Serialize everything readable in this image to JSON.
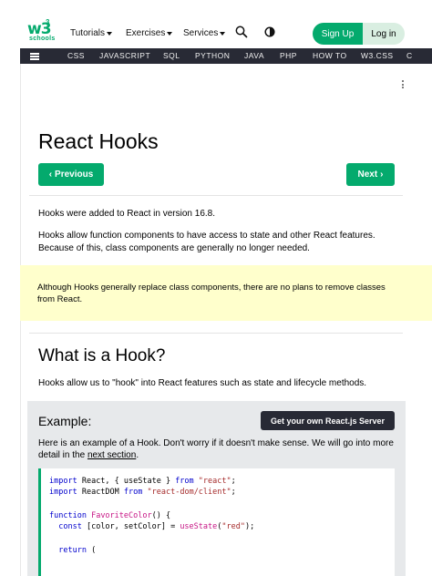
{
  "header": {
    "logo_text": "w3",
    "logo_superscript": "3",
    "logo_sub": "schools",
    "menus": [
      "Tutorials",
      "Exercises",
      "Services"
    ],
    "icons": [
      "search-icon",
      "contrast-icon"
    ],
    "signup_label": "Sign Up",
    "login_label": "Log in"
  },
  "topnav": {
    "items": [
      "CSS",
      "JAVASCRIPT",
      "SQL",
      "PYTHON",
      "JAVA",
      "PHP",
      "HOW TO",
      "W3.CSS",
      "C"
    ]
  },
  "page": {
    "title": "React Hooks",
    "prev_label": "Previous",
    "next_label": "Next",
    "intro1": "Hooks were added to React in version 16.8.",
    "intro2": "Hooks allow function components to have access to state and other React features. Because of this, class components are generally no longer needed.",
    "note": "Although Hooks generally replace class components, there are no plans to remove classes from React.",
    "section_title": "What is a Hook?",
    "section_text": "Hooks allow us to \"hook\" into React features such as state and lifecycle methods."
  },
  "example": {
    "title": "Example:",
    "server_button": "Get your own React.js Server",
    "text_before_link": "Here is an example of a Hook. Don't worry if it doesn't make sense. We will go into more detail in the ",
    "link_text": "next section",
    "text_after_link": ".",
    "code_lines": [
      "import React, { useState } from \"react\";",
      "import ReactDOM from \"react-dom/client\";",
      "",
      "function FavoriteColor() {",
      "  const [color, setColor] = useState(\"red\");",
      "",
      "  return ("
    ]
  },
  "colors": {
    "accent": "#04AA6D",
    "dark_nav": "#282A35",
    "note_bg": "#ffffcc",
    "example_bg": "#E7E9EB"
  }
}
